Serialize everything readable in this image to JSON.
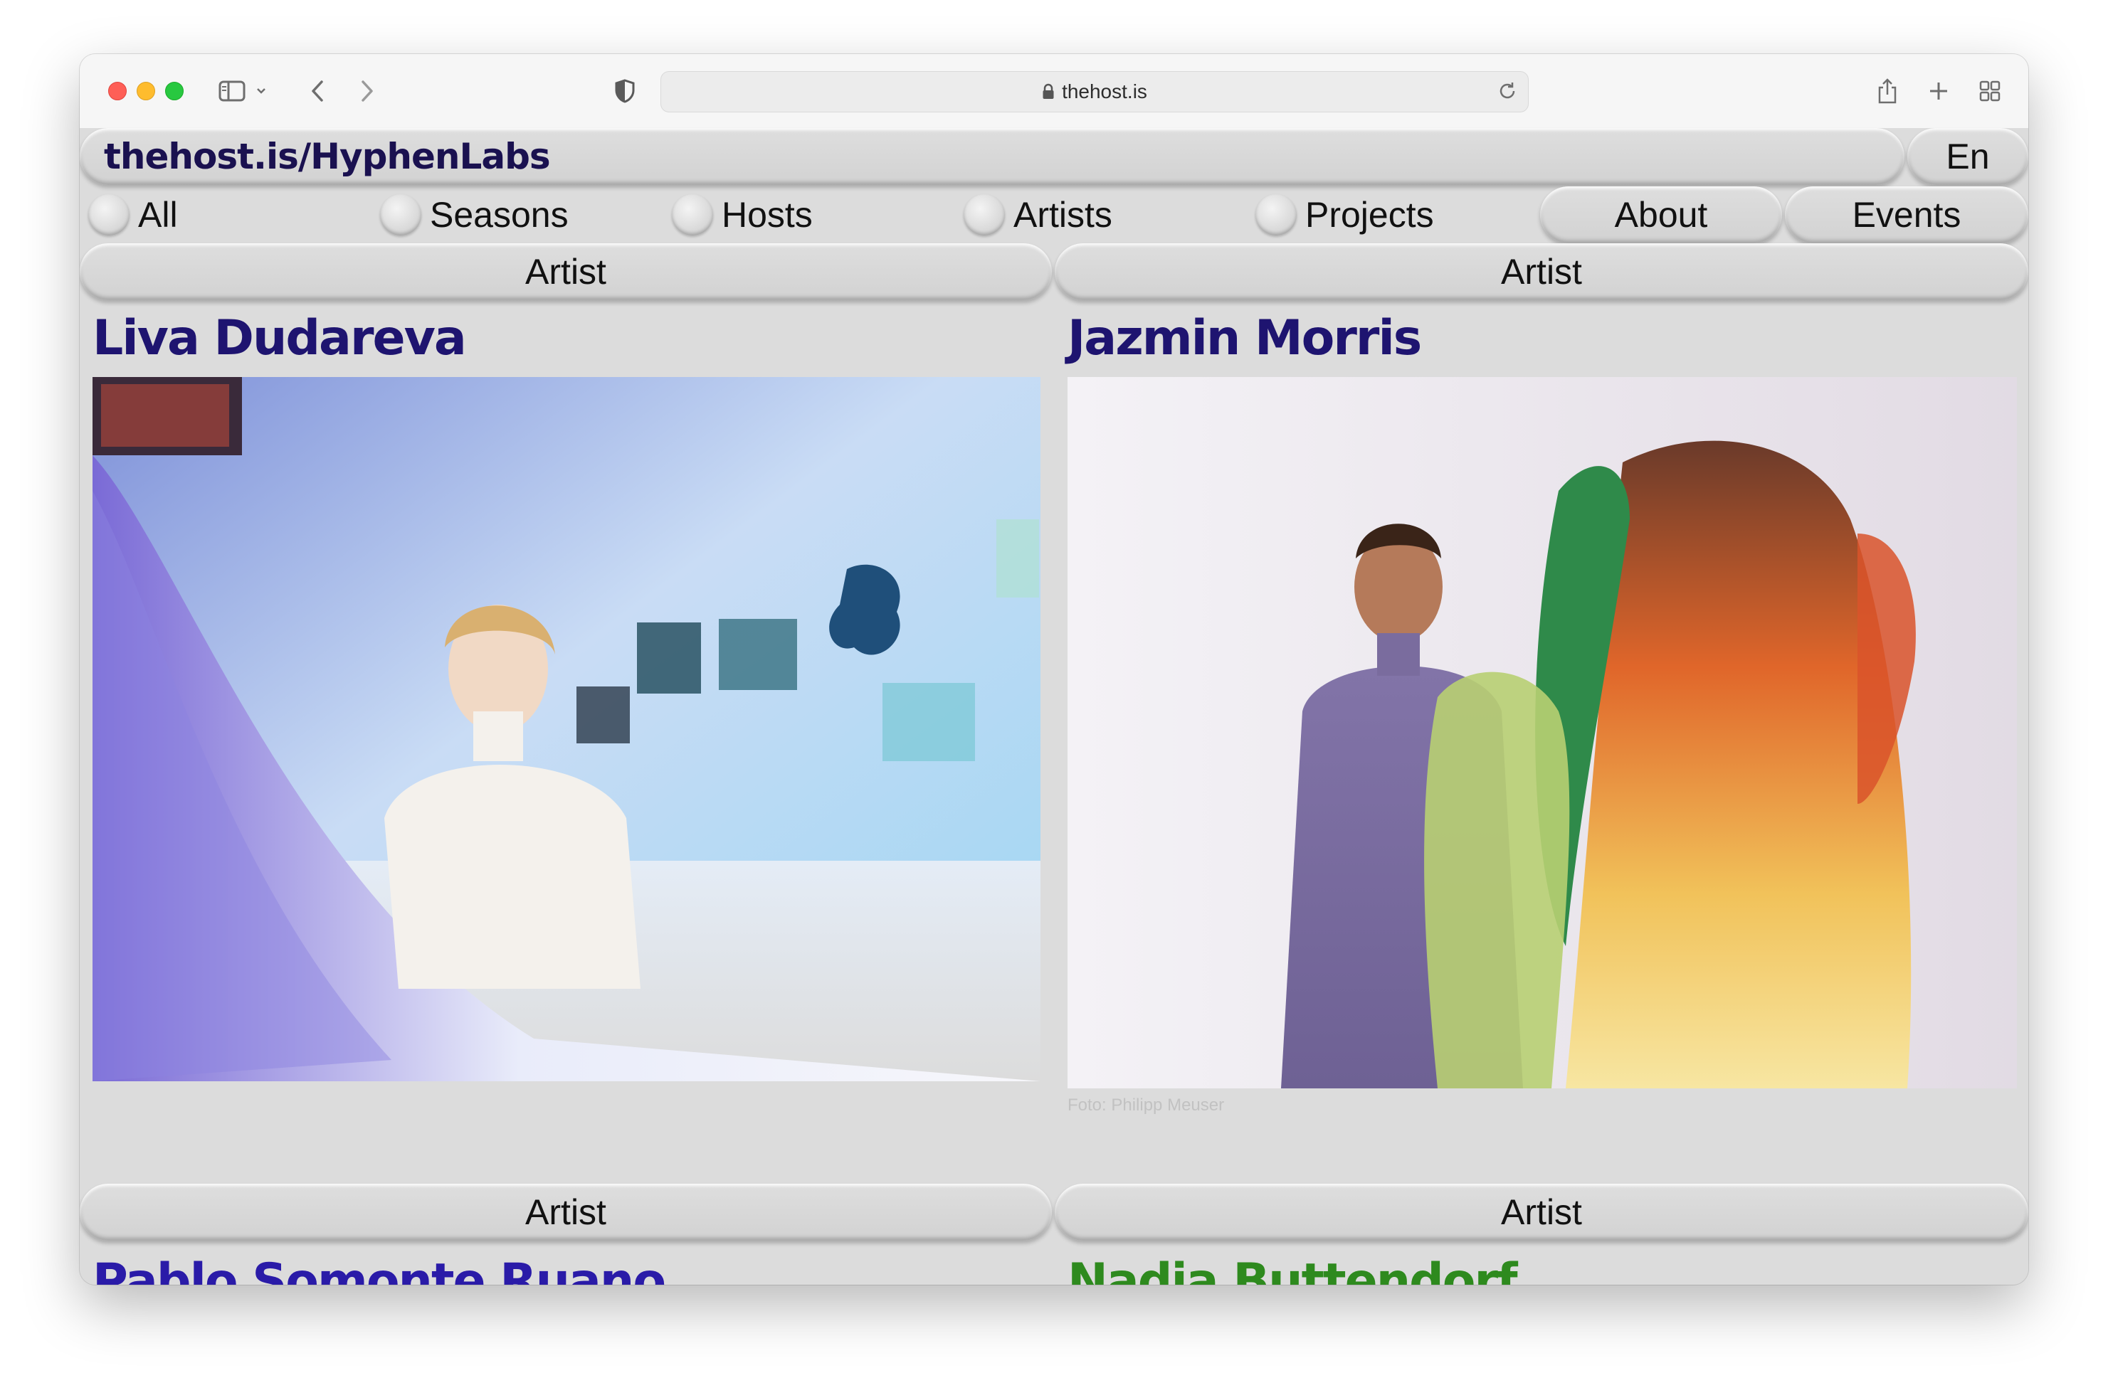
{
  "browser": {
    "url": "thehost.is"
  },
  "site": {
    "title": "thehost.is/HyphenLabs",
    "language": "En"
  },
  "nav": {
    "filters": [
      "All",
      "Seasons",
      "Hosts",
      "Artists",
      "Projects"
    ],
    "about": "About",
    "events": "Events"
  },
  "cards": [
    {
      "category": "Artist",
      "name": "Liva Dudareva",
      "name_color": "#1e1470",
      "caption": ""
    },
    {
      "category": "Artist",
      "name": "Jazmin Morris",
      "name_color": "#1e1470",
      "caption": "Foto: Philipp Meuser"
    },
    {
      "category": "Artist",
      "name": "Pablo Somonte Ruano",
      "name_color": "#2a1ba8"
    },
    {
      "category": "Artist",
      "name": "Nadia Buttendorf",
      "name_color": "#2e8a1e"
    }
  ]
}
